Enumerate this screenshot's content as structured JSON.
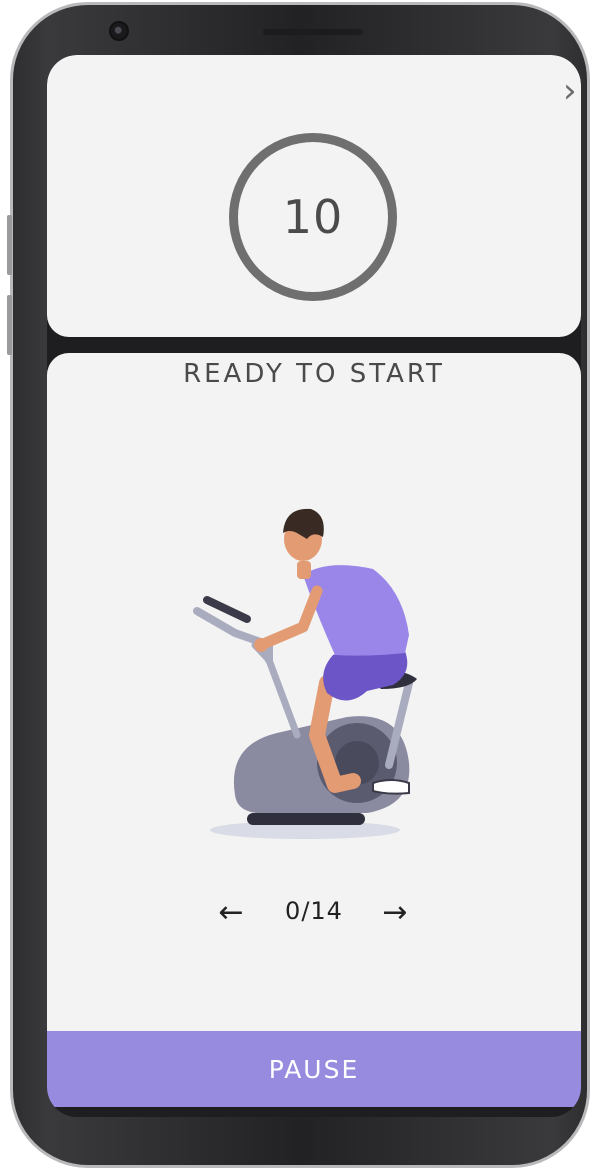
{
  "workout": {
    "countdown": "10",
    "status": "READY TO START",
    "exercise_icon": "stationary-bike-illustration"
  },
  "pager": {
    "progress": "0/14",
    "prev_icon": "arrow-left-icon",
    "next_icon": "arrow-right-icon"
  },
  "controls": {
    "close_icon": "close-icon",
    "pause_label": "PAUSE"
  },
  "colors": {
    "accent": "#968bdf",
    "ring": "#6f6f6f",
    "panel": "#f2f3f2",
    "shirt": "#9a86e8",
    "shorts": "#6b55c7",
    "bike": "#8a8aa0"
  }
}
